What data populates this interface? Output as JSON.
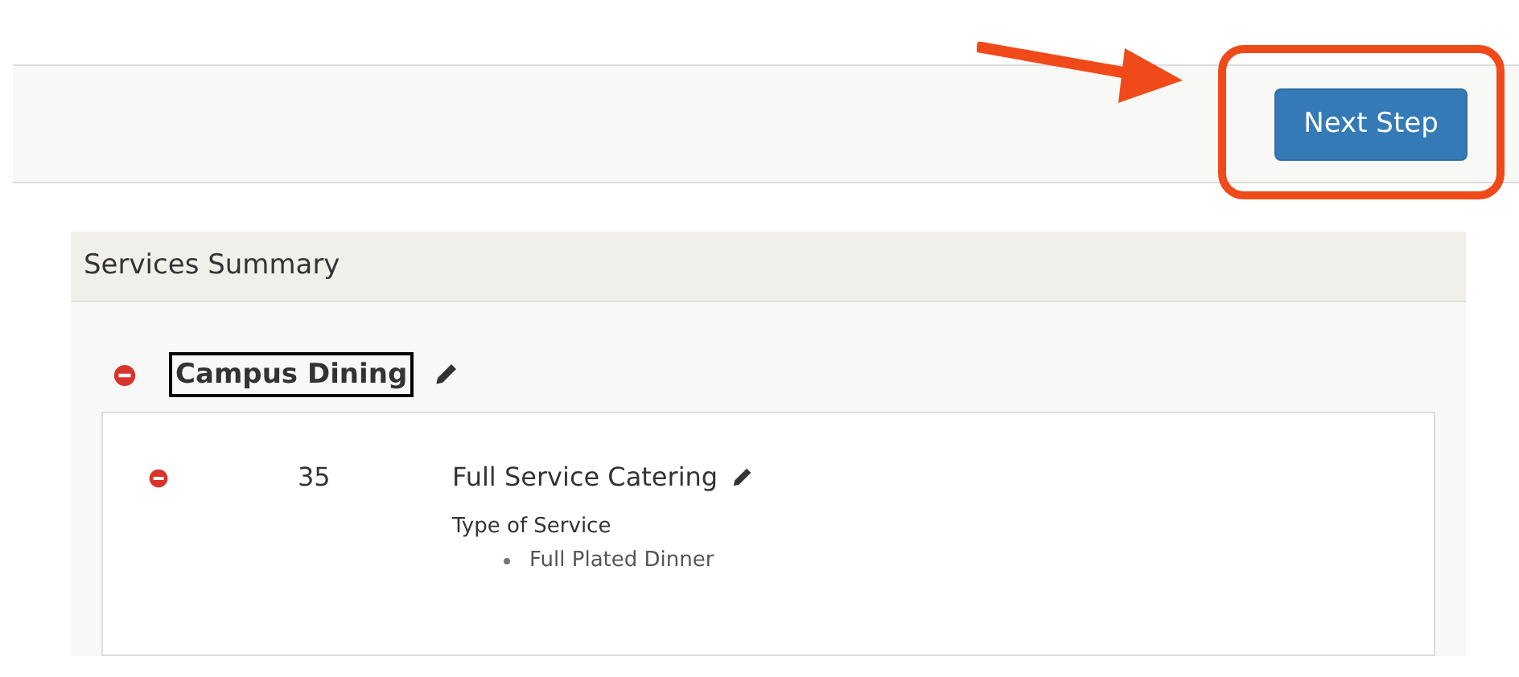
{
  "toolbar": {
    "button": "Next Step",
    "highlighted": true
  },
  "panel": {
    "title": "Services Summary",
    "vendors": [
      {
        "name": "Campus Dining",
        "focused": true,
        "services": [
          {
            "quantity": "35",
            "name": "Full Service Catering",
            "option_label": "Type of Service",
            "options": [
              "Full Plated Dinner"
            ]
          }
        ]
      }
    ]
  }
}
